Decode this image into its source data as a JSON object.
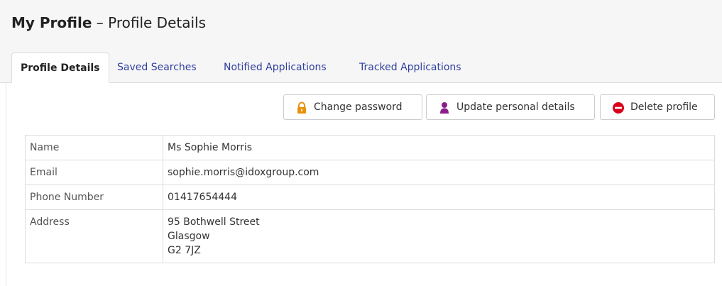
{
  "header": {
    "title_strong": "My Profile",
    "title_sep": " – ",
    "title_rest": "Profile Details"
  },
  "tabs": [
    {
      "label": "Profile Details",
      "active": true
    },
    {
      "label": "Saved Searches",
      "active": false
    },
    {
      "label": "Notified Applications",
      "active": false
    },
    {
      "label": "Tracked Applications",
      "active": false
    }
  ],
  "actions": {
    "change_password": {
      "label": "Change password",
      "icon": "lock-icon",
      "color": "#e8920c"
    },
    "update_details": {
      "label": "Update personal details",
      "icon": "user-icon",
      "color": "#8a1f8a"
    },
    "delete_profile": {
      "label": "Delete profile",
      "icon": "minus-circle-icon",
      "color": "#d9001b"
    }
  },
  "profile": {
    "name": {
      "label": "Name",
      "value": "Ms Sophie Morris"
    },
    "email": {
      "label": "Email",
      "value": "sophie.morris@idoxgroup.com"
    },
    "phone": {
      "label": "Phone Number",
      "value": "01417654444"
    },
    "address": {
      "label": "Address",
      "lines": [
        "95 Bothwell Street",
        "Glasgow",
        "G2 7JZ"
      ]
    }
  }
}
